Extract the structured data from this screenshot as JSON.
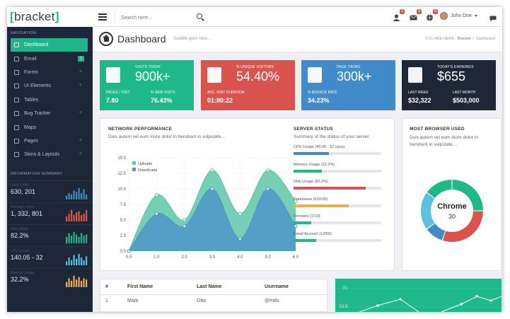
{
  "header": {
    "logo_open": "[",
    "logo_text": "bracket",
    "logo_close": "]",
    "search_placeholder": "Search here...",
    "notifications": [
      {
        "icon": "user-icon",
        "count": "2"
      },
      {
        "icon": "envelope-icon",
        "count": "5"
      },
      {
        "icon": "globe-icon",
        "count": "5"
      }
    ],
    "user_name": "John Doe",
    "chat_icon": "chat-icon"
  },
  "sidebar": {
    "nav_heading": "NAVIGATION",
    "items": [
      {
        "label": "Dashboard",
        "icon": "home-icon",
        "active": true
      },
      {
        "label": "Email",
        "icon": "envelope-icon",
        "count": "2"
      },
      {
        "label": "Forms",
        "icon": "edit-icon",
        "expand": "+"
      },
      {
        "label": "UI Elements",
        "icon": "suitcase-icon",
        "expand": "+"
      },
      {
        "label": "Tables",
        "icon": "th-icon"
      },
      {
        "label": "Bug Tracker",
        "icon": "bug-icon",
        "expand": "+"
      },
      {
        "label": "Maps",
        "icon": "map-marker-icon"
      },
      {
        "label": "Pages",
        "icon": "file-icon",
        "expand": "+"
      },
      {
        "label": "Skins & Layouts",
        "icon": "th-large-icon",
        "expand": "+"
      }
    ],
    "summary_heading": "INFORMATION SUMMARY",
    "summary": [
      {
        "label": "Daily Traffic",
        "value": "630, 201",
        "color": "#3c8dbc",
        "bars": [
          0.3,
          0.5,
          0.4,
          0.7,
          0.6,
          0.9,
          0.5,
          0.8,
          0.4
        ]
      },
      {
        "label": "Average Users",
        "value": "1, 332, 801",
        "color": "#d9534f",
        "bars": [
          0.4,
          0.6,
          0.9,
          0.5,
          0.7,
          0.8,
          0.5,
          0.6,
          0.9
        ]
      },
      {
        "label": "Disk Usage",
        "value": "82.2%",
        "color": "#20b48a",
        "bars": [
          0.5,
          0.8,
          0.6,
          0.9,
          0.7,
          0.5,
          0.8,
          0.6,
          0.7
        ]
      },
      {
        "label": "CPU Usage",
        "value": "140.05 - 32",
        "color": "#5bc0de",
        "bars": [
          0.3,
          0.6,
          0.4,
          0.8,
          0.5,
          0.9,
          0.6,
          0.4,
          0.7
        ]
      },
      {
        "label": "Memory Usage",
        "value": "32.2%",
        "color": "#f0ad4e",
        "bars": [
          0.4,
          0.7,
          0.5,
          0.9,
          0.6,
          0.8,
          0.5,
          0.7,
          0.6
        ]
      }
    ]
  },
  "page": {
    "title": "Dashboard",
    "subtitle": "Subtitle goes here...",
    "breadcrumb_label": "YOU ARE HERE:",
    "breadcrumb_link": "Bracket",
    "breadcrumb_current": "Dashboard"
  },
  "tiles": [
    {
      "color": "#1fb889",
      "icon": "users-icon",
      "label": "VISITS TODAY",
      "value": "900k+",
      "s1_label": "PAGES / VISIT",
      "s1_value": "7.80",
      "s2_label": "% NEW VISITS",
      "s2_value": "76.43%"
    },
    {
      "color": "#d9534f",
      "icon": "user-icon",
      "label": "% UNIQUE VISITORS",
      "value": "54.40%",
      "s1_label": "AVG. VISIT DURATION",
      "s1_value": "01:80:22",
      "s2_label": "",
      "s2_value": ""
    },
    {
      "color": "#428bca",
      "icon": "document-icon",
      "label": "PAGE VIEWS",
      "value": "300k+",
      "s1_label": "% BOUNCE RATE",
      "s1_value": "34.23%",
      "s2_label": "",
      "s2_value": ""
    },
    {
      "color": "#1d2738",
      "icon": "money-icon",
      "label": "TODAY'S EARNINGS",
      "value": "$655",
      "s1_label": "LAST WEEK",
      "s1_value": "$32,322",
      "s2_label": "LAST MONTH",
      "s2_value": "$503,000"
    }
  ],
  "network": {
    "heading": "NETWORK PERFORMANCE",
    "desc": "Duis autem vel eum iriure dolor in hendrerit in vulputate..."
  },
  "chart_data": {
    "type": "area",
    "x": [
      0,
      1,
      2,
      3,
      4,
      5,
      6
    ],
    "series": [
      {
        "name": "Uploads",
        "color": "#5ec7a8",
        "values": [
          0,
          9,
          5,
          13,
          6,
          13,
          8
        ]
      },
      {
        "name": "Downloads",
        "color": "#4f97c8",
        "values": [
          0,
          6,
          4,
          10,
          2,
          10,
          4
        ]
      }
    ],
    "xlim": [
      0,
      6
    ],
    "ylim": [
      0,
      15
    ],
    "xticks": [
      "0.0",
      "1.0",
      "2.0",
      "3.0",
      "4.0",
      "5.0",
      "6.0"
    ],
    "yticks": [
      "0.0",
      "2.5",
      "5.0",
      "7.5",
      "10.0",
      "12.5",
      "15.0"
    ],
    "legend": "top-left",
    "grid": true
  },
  "server": {
    "heading": "SERVER STATUS",
    "desc": "Summary of the status of your server.",
    "items": [
      {
        "label": "CPU Usage (40.05 - 32 cpus)",
        "percent": 40,
        "color": "#428bca"
      },
      {
        "label": "Memory Usage (32.2%)",
        "percent": 32.2,
        "color": "#1fb889"
      },
      {
        "label": "Disk Usage (82.2%)",
        "percent": 82.2,
        "color": "#d9534f"
      },
      {
        "label": "Databases (63/100)",
        "percent": 63,
        "color": "#f0ad4e"
      },
      {
        "label": "Domains (2/10)",
        "percent": 20,
        "color": "#1fb889"
      },
      {
        "label": "Email Account (13/50)",
        "percent": 26,
        "color": "#1fb889"
      }
    ]
  },
  "browser": {
    "heading": "MOST BROWSER USED",
    "desc": "Duis autem vel eum iriure dolor in hendrerit in vulputate...",
    "center_label": "Chrome",
    "center_value": "30",
    "segments": [
      {
        "percent": 25,
        "color": "#1fb889"
      },
      {
        "percent": 30,
        "color": "#d9534f"
      },
      {
        "percent": 10,
        "color": "#428bca"
      },
      {
        "percent": 20,
        "color": "#5bc0de"
      },
      {
        "percent": 15,
        "color": "#1fb889"
      }
    ]
  },
  "table": {
    "columns": [
      "#",
      "First Name",
      "Last Name",
      "Username"
    ],
    "rows": [
      [
        "1",
        "Mark",
        "Otto",
        "@mdo"
      ]
    ]
  },
  "line_panel": {
    "ticks": [
      "70",
      "52.5"
    ]
  }
}
